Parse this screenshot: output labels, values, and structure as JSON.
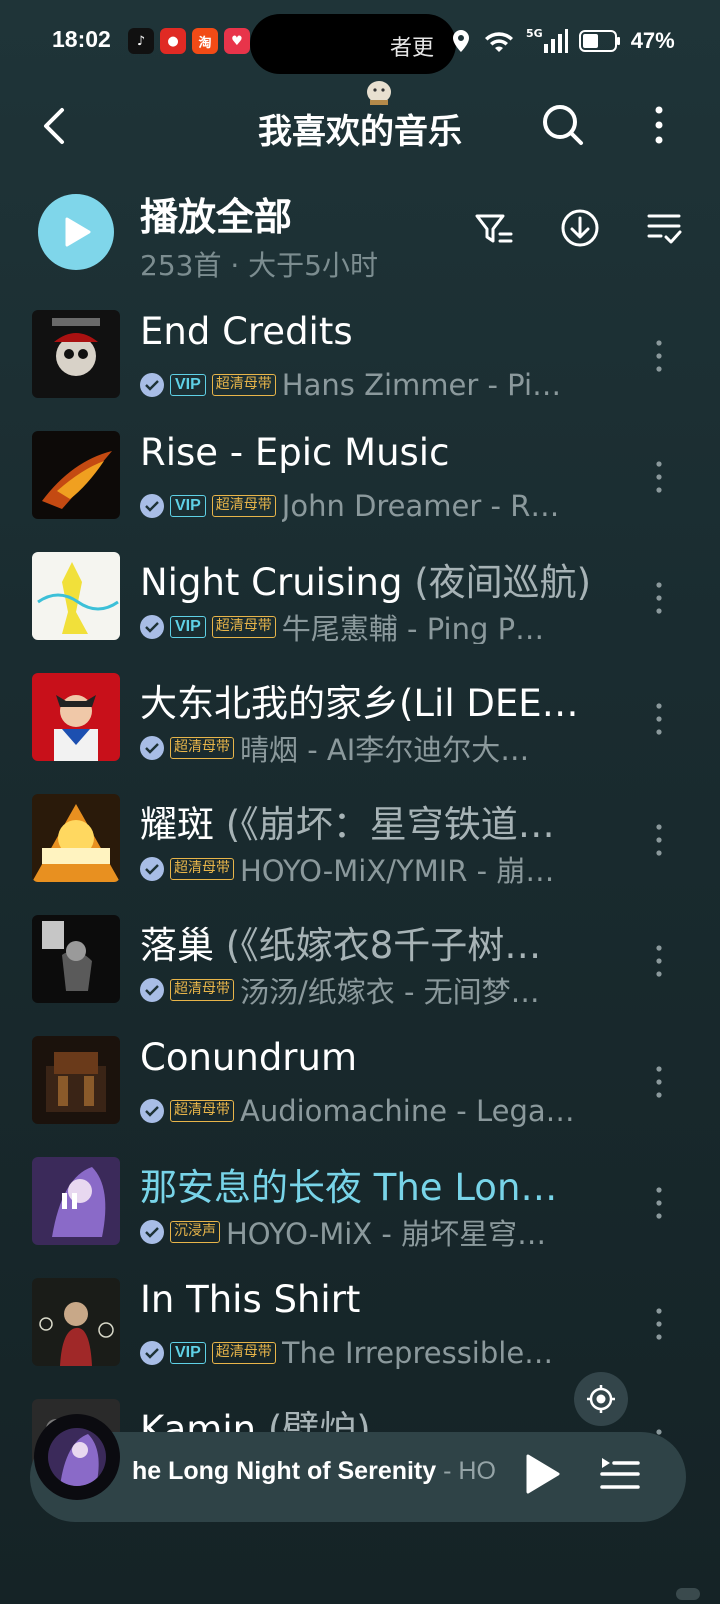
{
  "status_bar": {
    "time": "18:02",
    "pill_text": "者更",
    "network": "5G",
    "battery": "47%"
  },
  "header": {
    "title": "我喜欢的音乐"
  },
  "play_all": {
    "label": "播放全部",
    "subtitle": "253首 · 大于5小时"
  },
  "songs": [
    {
      "title": "End Credits",
      "extra": "",
      "vip": "VIP",
      "quality": "超清母带",
      "artist": "Hans Zimmer - Pi…",
      "playing": false
    },
    {
      "title": "Rise - Epic Music",
      "extra": "",
      "vip": "VIP",
      "quality": "超清母带",
      "artist": "John Dreamer - R…",
      "playing": false
    },
    {
      "title": "Night Cruising ",
      "extra": "(夜间巡航)",
      "vip": "VIP",
      "quality": "超清母带",
      "artist": "牛尾憲輔 - Ping P…",
      "playing": false
    },
    {
      "title": "大东北我的家乡(Lil DEE…",
      "extra": "",
      "vip": "",
      "quality": "超清母带",
      "artist": "晴烟 - AI李尔迪尔大…",
      "playing": false
    },
    {
      "title": "耀斑 ",
      "extra": "(《崩坏：星穹铁道…",
      "vip": "",
      "quality": "超清母带",
      "artist": "HOYO-MiX/YMIR - 崩…",
      "playing": false
    },
    {
      "title": "落巢 ",
      "extra": "(《纸嫁衣8千子树…",
      "vip": "",
      "quality": "超清母带",
      "artist": "汤汤/纸嫁衣 - 无间梦…",
      "playing": false
    },
    {
      "title": "Conundrum",
      "extra": "",
      "vip": "",
      "quality": "超清母带",
      "artist": "Audiomachine - Lega…",
      "playing": false
    },
    {
      "title": "那安息的长夜 The Lon…",
      "extra": "",
      "vip": "",
      "quality": "沉浸声",
      "artist": "HOYO-MiX - 崩坏星穹…",
      "playing": true
    },
    {
      "title": "In This Shirt",
      "extra": "",
      "vip": "VIP",
      "quality": "超清母带",
      "artist": "The Irrepressible…",
      "playing": false
    },
    {
      "title": "Kamin ",
      "extra": "(壁炉)",
      "vip": "",
      "quality": "",
      "artist": "",
      "playing": false
    }
  ],
  "mini_player": {
    "title": "he Long Night of Serenity",
    "artist": " - HO"
  },
  "colors": {
    "accent": "#7fd6ea",
    "playing_title": "#78d4e8",
    "vip_badge": "#5fd1e6",
    "quality_badge": "#e8b54a",
    "background": "#1f3438"
  },
  "icons": [
    "back-icon",
    "search-icon",
    "more-vertical-icon",
    "play-icon",
    "filter-icon",
    "download-icon",
    "multiselect-icon",
    "verified-check-icon",
    "locate-icon",
    "queue-icon"
  ]
}
